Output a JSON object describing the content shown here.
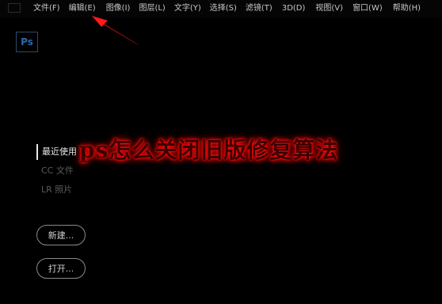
{
  "menu": {
    "items": [
      {
        "label": "文件(F)"
      },
      {
        "label": "编辑(E)"
      },
      {
        "label": "图像(I)"
      },
      {
        "label": "图层(L)"
      },
      {
        "label": "文字(Y)"
      },
      {
        "label": "选择(S)"
      },
      {
        "label": "滤镜(T)"
      },
      {
        "label": "3D(D)"
      },
      {
        "label": "视图(V)"
      },
      {
        "label": "窗口(W)"
      },
      {
        "label": "帮助(H)"
      }
    ]
  },
  "app": {
    "logo_text": "Ps"
  },
  "left_nav": {
    "items": [
      {
        "label": "最近使用",
        "active": true
      },
      {
        "label": "CC 文件",
        "active": false
      },
      {
        "label": "LR 照片",
        "active": false
      }
    ]
  },
  "actions": {
    "new_label": "新建...",
    "open_label": "打开..."
  },
  "overlay": {
    "title": "ps怎么关闭旧版修复算法"
  },
  "colors": {
    "background": "#000000",
    "overlay_glow": "#ff0000",
    "arrow": "#e01010",
    "logo_border": "#2a4a6e"
  }
}
